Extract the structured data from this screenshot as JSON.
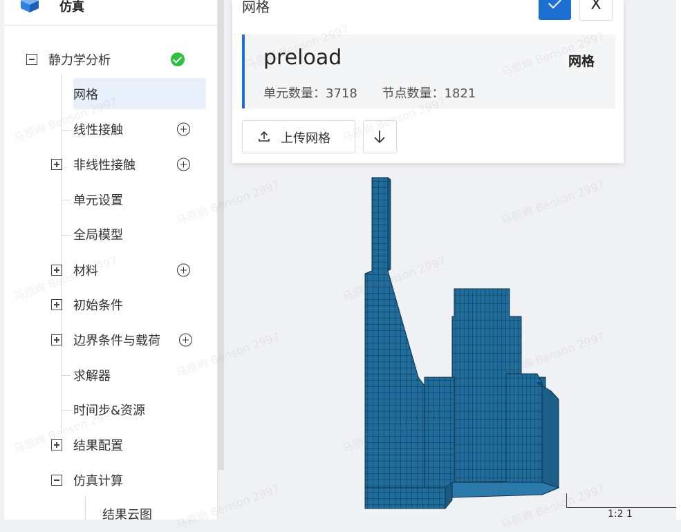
{
  "sidebar": {
    "title": "仿真",
    "tree": [
      {
        "label": "静力学分析",
        "toggle": "minus",
        "status": "complete"
      },
      {
        "label": "网格",
        "selected": true
      },
      {
        "label": "线性接触",
        "addable": true
      },
      {
        "label": "非线性接触",
        "toggle": "plus",
        "addable": true
      },
      {
        "label": "单元设置"
      },
      {
        "label": "全局模型"
      },
      {
        "label": "材料",
        "toggle": "plus",
        "addable": true
      },
      {
        "label": "初始条件",
        "toggle": "plus"
      },
      {
        "label": "边界条件与载荷",
        "toggle": "plus",
        "addable": true
      },
      {
        "label": "求解器"
      },
      {
        "label": "时间步&资源"
      },
      {
        "label": "结果配置",
        "toggle": "plus"
      },
      {
        "label": "仿真计算",
        "toggle": "minus"
      },
      {
        "label": "结果云图"
      }
    ]
  },
  "panel": {
    "title": "网格",
    "mesh": {
      "name": "preload",
      "tag": "网格",
      "element_count": "单元数量：3718",
      "node_count": "节点数量：1821"
    },
    "upload_label": "上传网格",
    "close_label": "X"
  },
  "viewport": {
    "axis_label": "1:2 1",
    "mesh_color": "#1f6d9c"
  },
  "watermark": "马原峋 Benson 2997"
}
